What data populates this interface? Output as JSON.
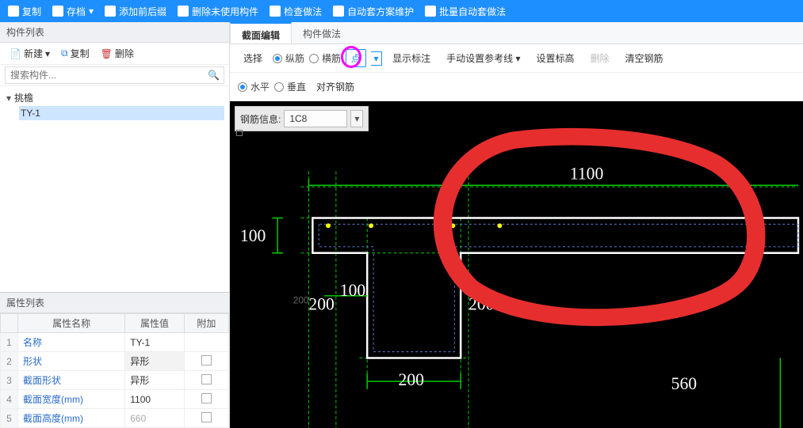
{
  "top_toolbar": {
    "copy": "复制",
    "archive": "存档",
    "add_prefix": "添加前后缀",
    "delete_unused": "删除未使用构件",
    "check_method": "检查做法",
    "auto_scheme": "自动套方案维护",
    "batch_method": "批量自动套做法"
  },
  "left": {
    "component_list_title": "构件列表",
    "toolbar": {
      "new": "新建",
      "copy": "复制",
      "delete": "删除"
    },
    "search_placeholder": "搜索构件...",
    "tree": {
      "parent": "挑檐",
      "child": "TY-1"
    },
    "property_list_title": "属性列表",
    "prop_headers": {
      "name": "属性名称",
      "value": "属性值",
      "extra": "附加"
    },
    "props": [
      {
        "n": "1",
        "name": "名称",
        "value": "TY-1"
      },
      {
        "n": "2",
        "name": "形状",
        "value": "异形"
      },
      {
        "n": "3",
        "name": "截面形状",
        "value": "异形"
      },
      {
        "n": "4",
        "name": "截面宽度(mm)",
        "value": "1100"
      },
      {
        "n": "5",
        "name": "截面高度(mm)",
        "value": "660"
      }
    ]
  },
  "right": {
    "tabs": {
      "section": "截面编辑",
      "method": "构件做法"
    },
    "row1": {
      "select": "选择",
      "vert_rebar": "纵筋",
      "horiz_rebar": "横筋",
      "point": "点",
      "show_label": "显示标注",
      "manual_ref": "手动设置参考线",
      "set_elev": "设置标高",
      "delete": "删除",
      "clear_rebar": "清空钢筋"
    },
    "row2": {
      "horizontal": "水平",
      "vertical": "垂直",
      "align_rebar": "对齐钢筋"
    },
    "rebar_info_label": "钢筋信息:",
    "rebar_info_value": "1C8",
    "dims": {
      "d1100": "1100",
      "d100a": "100",
      "d100b": "100",
      "d200a": "200",
      "d200b": "200",
      "d200c": "200",
      "d200_small": "200",
      "d560": "560"
    }
  },
  "glyphs": {
    "search": "🔍",
    "chev_down": "▾",
    "new_icon": "＋",
    "copy_icon": "⧉",
    "del_icon": "✕"
  }
}
